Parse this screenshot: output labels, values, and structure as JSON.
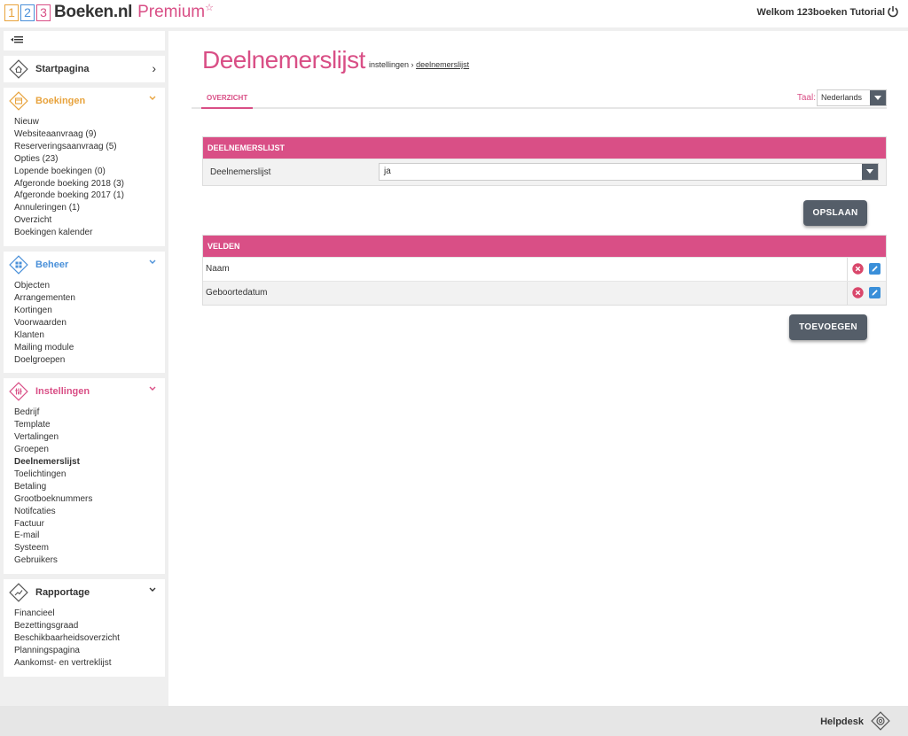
{
  "header": {
    "logo_digits": [
      "1",
      "2",
      "3"
    ],
    "brand": "Boeken.nl",
    "premium": "Premium",
    "star": "☆",
    "welcome": "Welkom 123boeken Tutorial"
  },
  "sidebar": {
    "sections": [
      {
        "title": "Startpagina",
        "color": "#333333",
        "chevron": "›",
        "items": []
      },
      {
        "title": "Boekingen",
        "color": "#e8a33d",
        "chevron": "⌄",
        "items": [
          "Nieuw",
          "Websiteaanvraag (9)",
          "Reserveringsaanvraag (5)",
          "Opties (23)",
          "Lopende boekingen (0)",
          "Afgeronde boeking 2018 (3)",
          "Afgeronde boeking 2017 (1)",
          "Annuleringen (1)",
          "Overzicht",
          "Boekingen kalender"
        ]
      },
      {
        "title": "Beheer",
        "color": "#4a90d9",
        "chevron": "⌄",
        "items": [
          "Objecten",
          "Arrangementen",
          "Kortingen",
          "Voorwaarden",
          "Klanten",
          "Mailing module",
          "Doelgroepen"
        ]
      },
      {
        "title": "Instellingen",
        "color": "#d94f86",
        "chevron": "⌄",
        "items": [
          "Bedrijf",
          "Template",
          "Vertalingen",
          "Groepen",
          "Deelnemerslijst",
          "Toelichtingen",
          "Betaling",
          "Grootboeknummers",
          "Notifcaties",
          "Factuur",
          "E-mail",
          "Systeem",
          "Gebruikers"
        ],
        "active_item": "Deelnemerslijst"
      },
      {
        "title": "Rapportage",
        "color": "#333333",
        "chevron": "⌄",
        "items": [
          "Financieel",
          "Bezettingsgraad",
          "Beschikbaarheidsoverzicht",
          "Planningspagina",
          "Aankomst- en vertreklijst"
        ]
      }
    ]
  },
  "main": {
    "title": "Deelnemerslijst",
    "breadcrumb_parent": "instellingen",
    "breadcrumb_sep": "›",
    "breadcrumb_current": "deelnemerslijst",
    "tab": "OVERZICHT",
    "taal_label": "Taal:",
    "taal_value": "Nederlands",
    "deelnemers_box": {
      "header": "DEELNEMERSLIJST",
      "field_label": "Deelnemerslijst",
      "field_value": "ja"
    },
    "save_button": "OPSLAAN",
    "velden_box": {
      "header": "VELDEN",
      "rows": [
        "Naam",
        "Geboortedatum"
      ]
    },
    "add_button": "TOEVOEGEN"
  },
  "footer": {
    "helpdesk": "Helpdesk"
  },
  "colors": {
    "accent": "#d94f86",
    "button": "#555e69",
    "delete": "#d9476b",
    "edit": "#3a8fd9"
  }
}
